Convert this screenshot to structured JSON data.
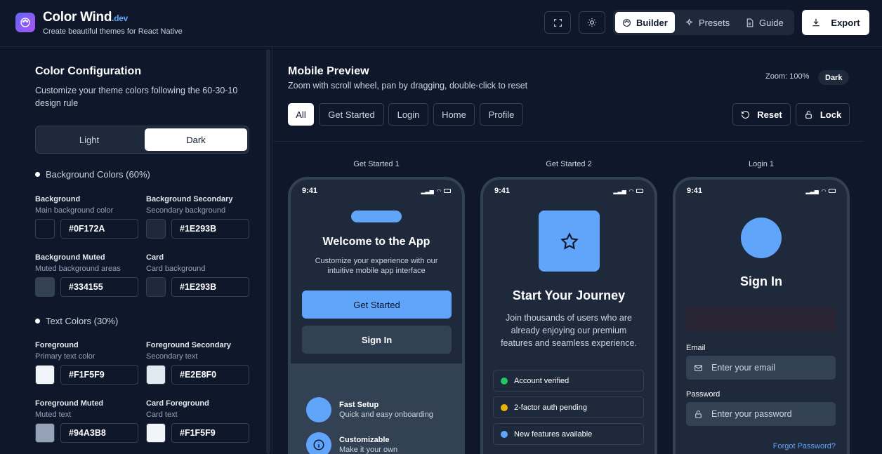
{
  "header": {
    "title": "Color Wind",
    "title_suffix": ".dev",
    "subtitle": "Create beautiful themes for React Native",
    "nav": [
      {
        "label": "Builder",
        "icon": "palette-icon",
        "active": true
      },
      {
        "label": "Presets",
        "icon": "sparkles-icon",
        "active": false
      },
      {
        "label": "Guide",
        "icon": "file-icon",
        "active": false
      }
    ],
    "export_label": "Export"
  },
  "config": {
    "title": "Color Configuration",
    "description": "Customize your theme colors following the 60-30-10 design rule",
    "modes": [
      "Light",
      "Dark"
    ],
    "active_mode": "Dark",
    "sections": [
      {
        "title": "Background Colors (60%)",
        "fields": [
          {
            "label": "Background",
            "sub": "Main background color",
            "hex": "#0F172A"
          },
          {
            "label": "Background Secondary",
            "sub": "Secondary background",
            "hex": "#1E293B"
          },
          {
            "label": "Background Muted",
            "sub": "Muted background areas",
            "hex": "#334155"
          },
          {
            "label": "Card",
            "sub": "Card background",
            "hex": "#1E293B"
          }
        ]
      },
      {
        "title": "Text Colors (30%)",
        "fields": [
          {
            "label": "Foreground",
            "sub": "Primary text color",
            "hex": "#F1F5F9"
          },
          {
            "label": "Foreground Secondary",
            "sub": "Secondary text",
            "hex": "#E2E8F0"
          },
          {
            "label": "Foreground Muted",
            "sub": "Muted text",
            "hex": "#94A3B8"
          },
          {
            "label": "Card Foreground",
            "sub": "Card text",
            "hex": "#F1F5F9"
          }
        ]
      }
    ]
  },
  "preview": {
    "title": "Mobile Preview",
    "description": "Zoom with scroll wheel, pan by dragging, double-click to reset",
    "zoom": "Zoom: 100%",
    "mode_badge": "Dark",
    "filters": [
      "All",
      "Get Started",
      "Login",
      "Home",
      "Profile"
    ],
    "active_filter": "All",
    "reset_label": "Reset",
    "lock_label": "Lock",
    "phones": [
      {
        "label": "Get Started 1",
        "time": "9:41",
        "heading": "Welcome to the App",
        "text": "Customize your experience with our intuitive mobile app interface",
        "primary_btn": "Get Started",
        "secondary_btn": "Sign In",
        "features": [
          {
            "title": "Fast Setup",
            "sub": "Quick and easy onboarding",
            "icon": "blank-circle-icon"
          },
          {
            "title": "Customizable",
            "sub": "Make it your own",
            "icon": "info-icon"
          }
        ]
      },
      {
        "label": "Get Started 2",
        "time": "9:41",
        "heading": "Start Your Journey",
        "text": "Join thousands of users who are already enjoying our premium features and seamless experience.",
        "statuses": [
          {
            "label": "Account verified",
            "color": "#22C55E"
          },
          {
            "label": "2-factor auth pending",
            "color": "#EAB308"
          },
          {
            "label": "New features available",
            "color": "#60A5FA"
          }
        ]
      },
      {
        "label": "Login 1",
        "time": "9:41",
        "heading": "Sign In",
        "email_label": "Email",
        "email_placeholder": "Enter your email",
        "password_label": "Password",
        "password_placeholder": "Enter your password",
        "forgot": "Forgot Password?"
      }
    ]
  },
  "colors": {
    "accent": "#60A5FA",
    "bg": "#0F172A",
    "bg_secondary": "#1E293B",
    "muted": "#334155"
  }
}
